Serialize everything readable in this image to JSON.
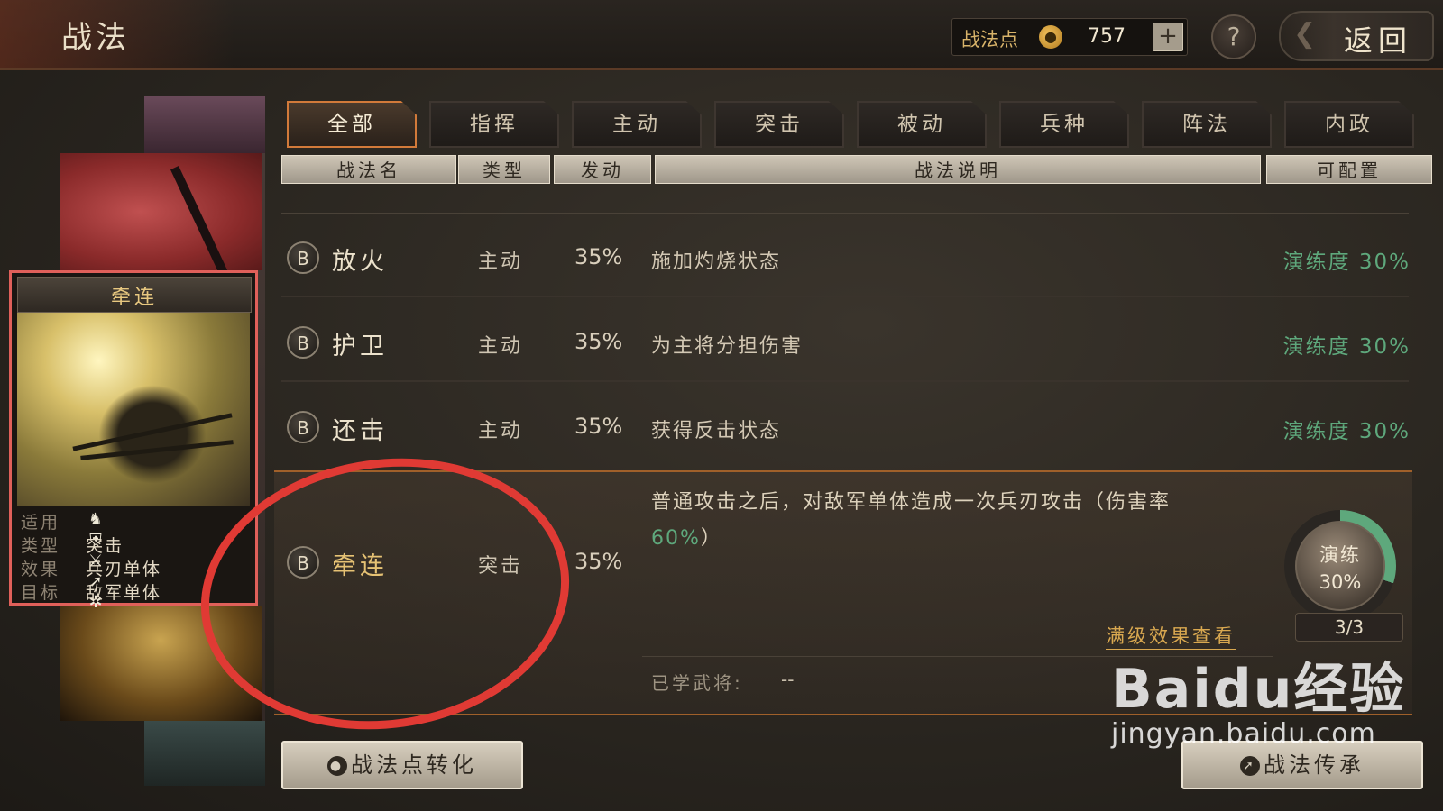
{
  "header": {
    "title": "战法",
    "points_label": "战法点",
    "points_icon": "tactic-point-coin-icon",
    "points_value": "757",
    "plus_symbol": "+",
    "help_symbol": "?",
    "back_label": "返回"
  },
  "tabs": [
    {
      "label": "全部",
      "active": true
    },
    {
      "label": "指挥",
      "active": false
    },
    {
      "label": "主动",
      "active": false
    },
    {
      "label": "突击",
      "active": false
    },
    {
      "label": "被动",
      "active": false
    },
    {
      "label": "兵种",
      "active": false
    },
    {
      "label": "阵法",
      "active": false
    },
    {
      "label": "内政",
      "active": false
    }
  ],
  "columns": {
    "name": "战法名",
    "type": "类型",
    "trigger": "发动",
    "description": "战法说明",
    "configurable": "可配置"
  },
  "rows": [
    {
      "grade": "B",
      "name": "放火",
      "type": "主动",
      "rate": "35%",
      "desc": "施加灼烧状态",
      "progress": "演练度 30%"
    },
    {
      "grade": "B",
      "name": "护卫",
      "type": "主动",
      "rate": "35%",
      "desc": "为主将分担伤害",
      "progress": "演练度 30%"
    },
    {
      "grade": "B",
      "name": "还击",
      "type": "主动",
      "rate": "35%",
      "desc": "获得反击状态",
      "progress": "演练度 30%"
    }
  ],
  "selected": {
    "grade": "B",
    "name": "牵连",
    "type": "突击",
    "rate": "35%",
    "desc_part1": "普通攻击之后，对敌军单体造成一次兵刃攻击（伤害率",
    "desc_highlight": "60%",
    "desc_part2": "）",
    "fullview_label": "满级效果查看",
    "learned_label": "已学武将:",
    "learned_value": "--",
    "practice_label": "演练",
    "practice_pct": "30%",
    "practice_fraction": 0.3,
    "practice_count": "3/3"
  },
  "card": {
    "name": "牵连",
    "applicable_key": "适用",
    "applicable_icons": [
      "cavalry-icon",
      "shield-icon",
      "crossed-weapons-icon",
      "bow-icon",
      "wheel-icon"
    ],
    "type_key": "类型",
    "type_val": "突击",
    "effect_key": "效果",
    "effect_val": "兵刃单体",
    "target_key": "目标",
    "target_val": "敌军单体"
  },
  "buttons": {
    "convert_label": "战法点转化",
    "inherit_label": "战法传承"
  },
  "watermark": {
    "main": "Baidu经验",
    "sub": "jingyan.baidu.com"
  },
  "colors": {
    "accent_orange": "#d27a3a",
    "progress_green": "#5ea87c",
    "annotation_red": "#e03a34",
    "card_border": "#e0605a"
  }
}
